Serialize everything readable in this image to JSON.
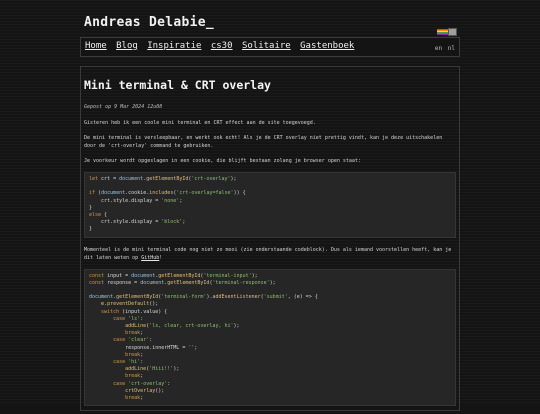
{
  "site": {
    "title": "Andreas Delabie_"
  },
  "nav": {
    "links": [
      "Home",
      "Blog",
      "Inspiratie",
      "cs30",
      "Solitaire",
      "Gastenboek"
    ],
    "languages": [
      "en",
      "nl"
    ]
  },
  "article": {
    "title": "Mini terminal & CRT overlay",
    "posted": "Gepost op 9 Mar 2024 12u08",
    "p1": "Gisteren heb ik een coole mini terminal en CRT effect aan de site toegevoegd.",
    "p2": "De mini terminal is versleepbaar, en werkt ook echt! Als je de CRT overlay niet prettig vindt, kan je deze uitschakelen door de 'crt-overlay' command te gebruiken.",
    "p3": "Je voorkeur wordt opgeslagen in een cookie, die blijft bestaan zolang je browser open staat:",
    "p4_before": "Momenteel is de mini terminal code nog niet zo mooi (zie onderstaande codeblock). Dus als iemand voorstellen heeft, kan je dit laten weten op ",
    "p4_link": "GitHub",
    "p4_after": "!",
    "code1": [
      "let crt = document.getElementById('crt-overlay');",
      "",
      "if (document.cookie.includes('crt-overlay=false')) {",
      "    crt.style.display = 'none';",
      "}",
      "else {",
      "    crt.style.display = 'block';",
      "}"
    ],
    "code2": [
      "const input = document.getElementById('terminal-input');",
      "const response = document.getElementById('terminal-response');",
      "",
      "document.getElementById('terminal-form').addEventListener('submit', (e) => {",
      "    e.preventDefault();",
      "    switch (input.value) {",
      "        case 'ls':",
      "            addLine('ls, clear, crt-overlay, hi');",
      "            break;",
      "        case 'clear':",
      "            response.innerHTML = '';",
      "            break;",
      "        case 'hi':",
      "            addLine('Hiii!!');",
      "            break;",
      "        case 'crt-overlay':",
      "            crtOverlay();",
      "            break;"
    ]
  }
}
